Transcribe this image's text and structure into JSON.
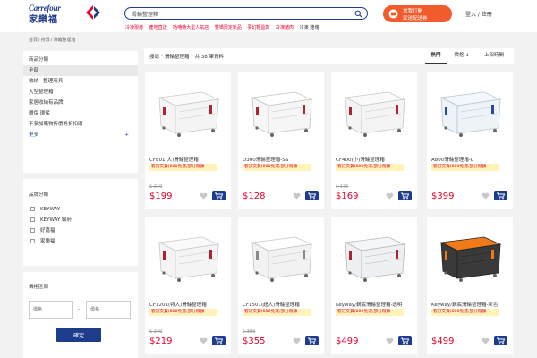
{
  "header": {
    "logo_en": "Carrefour",
    "logo_zh": "家樂福",
    "search": {
      "value": "滑輪整理箱",
      "placeholder": ""
    },
    "hot_words": [
      {
        "label": "冷凍現烤",
        "color": "red"
      },
      {
        "label": "產地直送",
        "color": "red"
      },
      {
        "label": "咕嚕嚕大型人氣店",
        "color": "red"
      },
      {
        "label": "雙嬌限定新品",
        "color": "red"
      },
      {
        "label": "夢幻輕盈款",
        "color": "red"
      },
      {
        "label": "冷凍豬肉",
        "color": "red"
      },
      {
        "label": "冷凍 雞塊",
        "color": "dark"
      }
    ],
    "promo": {
      "line1": "當我打開",
      "line2": "家送配送券"
    },
    "login": "登入 / 註冊"
  },
  "breadcrumb": [
    "首頁",
    "搜尋",
    "滑輪整理箱"
  ],
  "sidebar": {
    "category_title": "商品分類",
    "categories": [
      {
        "label": "全部",
        "active": true
      },
      {
        "label": "收納 · 整理用具",
        "active": false
      },
      {
        "label": "大型整理箱",
        "active": false
      },
      {
        "label": "家居收納有品牌",
        "active": false
      },
      {
        "label": "環保 環保",
        "active": false
      },
      {
        "label": "不參加購物折價券折扣環",
        "active": false
      }
    ],
    "more": "更多",
    "more_icon": "+",
    "brand_title": "品牌分類",
    "brands": [
      "KEYWAY",
      "KEYWAY 聯府",
      "好嘉福",
      "家樂福"
    ],
    "price_title": "價格區間",
    "price_min_placeholder": "價格",
    "price_max_placeholder": "價格",
    "price_dash": "-",
    "confirm": "確定"
  },
  "results": {
    "summary": "搜尋 \" 滑輪整理箱 \" 共 38 筆資料",
    "sort_tabs": [
      {
        "label": "熱門",
        "active": true
      },
      {
        "label": "價格 ↓",
        "active": false
      },
      {
        "label": "上架時間",
        "active": false
      }
    ]
  },
  "products": [
    {
      "name": "CF801(大)滑輪整理箱",
      "badge": "客訂交貨(800免運,部分限額",
      "old_price": "$ 219",
      "price": "$199",
      "type": "white-big"
    },
    {
      "name": "D300滑輪整理箱-SS",
      "badge": "客訂交貨(800免運,部分限額",
      "old_price": "",
      "price": "$128",
      "type": "white-red"
    },
    {
      "name": "CF400(小)滑輪整理箱",
      "badge": "客訂交貨(800免運,部分限額",
      "old_price": "$ 175",
      "price": "$169",
      "type": "white-small"
    },
    {
      "name": "A800滑輪整理箱-L",
      "badge": "客訂交貨(800免運,部分限額",
      "old_price": "",
      "price": "$399",
      "type": "clear-blue"
    },
    {
      "name": "CF1201(特大)滑輪整理箱",
      "badge": "客訂交貨(800免運,部分限額",
      "old_price": "$ 249",
      "price": "$219",
      "type": "white-big"
    },
    {
      "name": "CF1501(超大)滑輪整理箱",
      "badge": "客訂交貨(800免運,部分限額",
      "old_price": "$ 399",
      "price": "$355",
      "type": "white-lidded"
    },
    {
      "name": "Keyway/鋼底滑輪整理箱-透明",
      "badge": "客訂交貨(800免運,部分限額",
      "old_price": "",
      "price": "$499",
      "type": "clear-red"
    },
    {
      "name": "Keyway/鋼底滑輪整理箱-灰色",
      "badge": "客訂交貨(800免運,部分限額",
      "old_price": "",
      "price": "$499",
      "type": "black-orange"
    }
  ],
  "colors": {
    "brand_blue": "#1e3c8c",
    "brand_red": "#e4002b",
    "promo_orange": "#f25c2c",
    "badge_yellow": "#fff3b8"
  },
  "icons": {
    "search": "search-icon",
    "promo": "chat-icon",
    "wishlist": "heart-icon",
    "cart": "cart-icon",
    "logo": "carrefour-logo-icon"
  }
}
